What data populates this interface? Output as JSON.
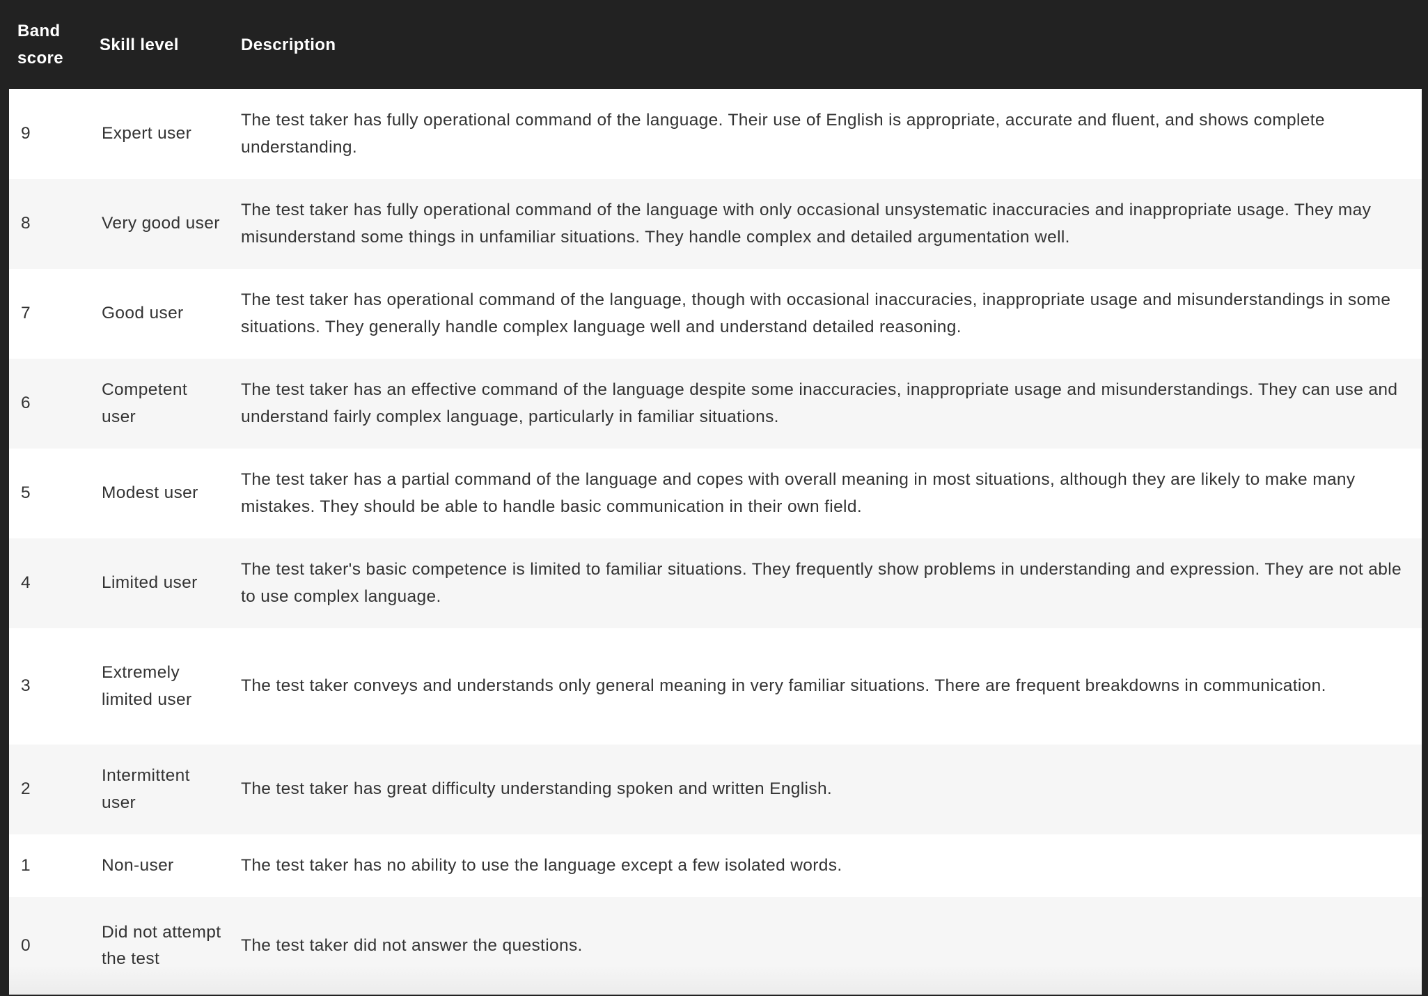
{
  "table": {
    "headers": {
      "band": "Band score",
      "skill": "Skill level",
      "description": "Description"
    },
    "rows": [
      {
        "band": "9",
        "skill": "Expert user",
        "description": "The test taker has fully operational command of the language. Their use of English is appropriate, accurate and fluent, and shows complete understanding."
      },
      {
        "band": "8",
        "skill": "Very good user",
        "description": "The test taker has fully operational command of the language with only occasional unsystematic inaccuracies and inappropriate usage. They may misunderstand some things in unfamiliar situations. They handle complex and detailed argumentation well."
      },
      {
        "band": "7",
        "skill": "Good user",
        "description": "The test taker has operational command of the language, though with occasional inaccuracies, inappropriate usage and misunderstandings in some situations. They generally handle complex language well and understand detailed reasoning."
      },
      {
        "band": "6",
        "skill": "Competent user",
        "description": "The test taker has an effective command of the language despite some inaccuracies, inappropriate usage and misunderstandings. They can use and understand fairly complex language, particularly in familiar situations."
      },
      {
        "band": "5",
        "skill": "Modest user",
        "description": "The test taker has a partial command of the language and copes with overall meaning in most situations, although they are likely to make many mistakes. They should be able to handle basic communication in their own field."
      },
      {
        "band": "4",
        "skill": "Limited user",
        "description": "The test taker's basic competence is limited to familiar situations. They frequently show problems in understanding and expression. They are not able to use complex language."
      },
      {
        "band": "3",
        "skill": "Extremely limited user",
        "description": "The test taker conveys and understands only general meaning in very familiar situations. There are frequent breakdowns in communication."
      },
      {
        "band": "2",
        "skill": "Intermittent user",
        "description": "The test taker has great difficulty understanding spoken and written English."
      },
      {
        "band": "1",
        "skill": "Non-user",
        "description": "The test taker has no ability to use the language except a few isolated words."
      },
      {
        "band": "0",
        "skill": "Did not attempt the test",
        "description": "The test taker did not answer the questions."
      }
    ]
  },
  "colors": {
    "header_bg": "#222222",
    "header_text": "#ffffff",
    "row_odd": "#ffffff",
    "row_even": "#f6f6f6",
    "body_text": "#333333"
  }
}
